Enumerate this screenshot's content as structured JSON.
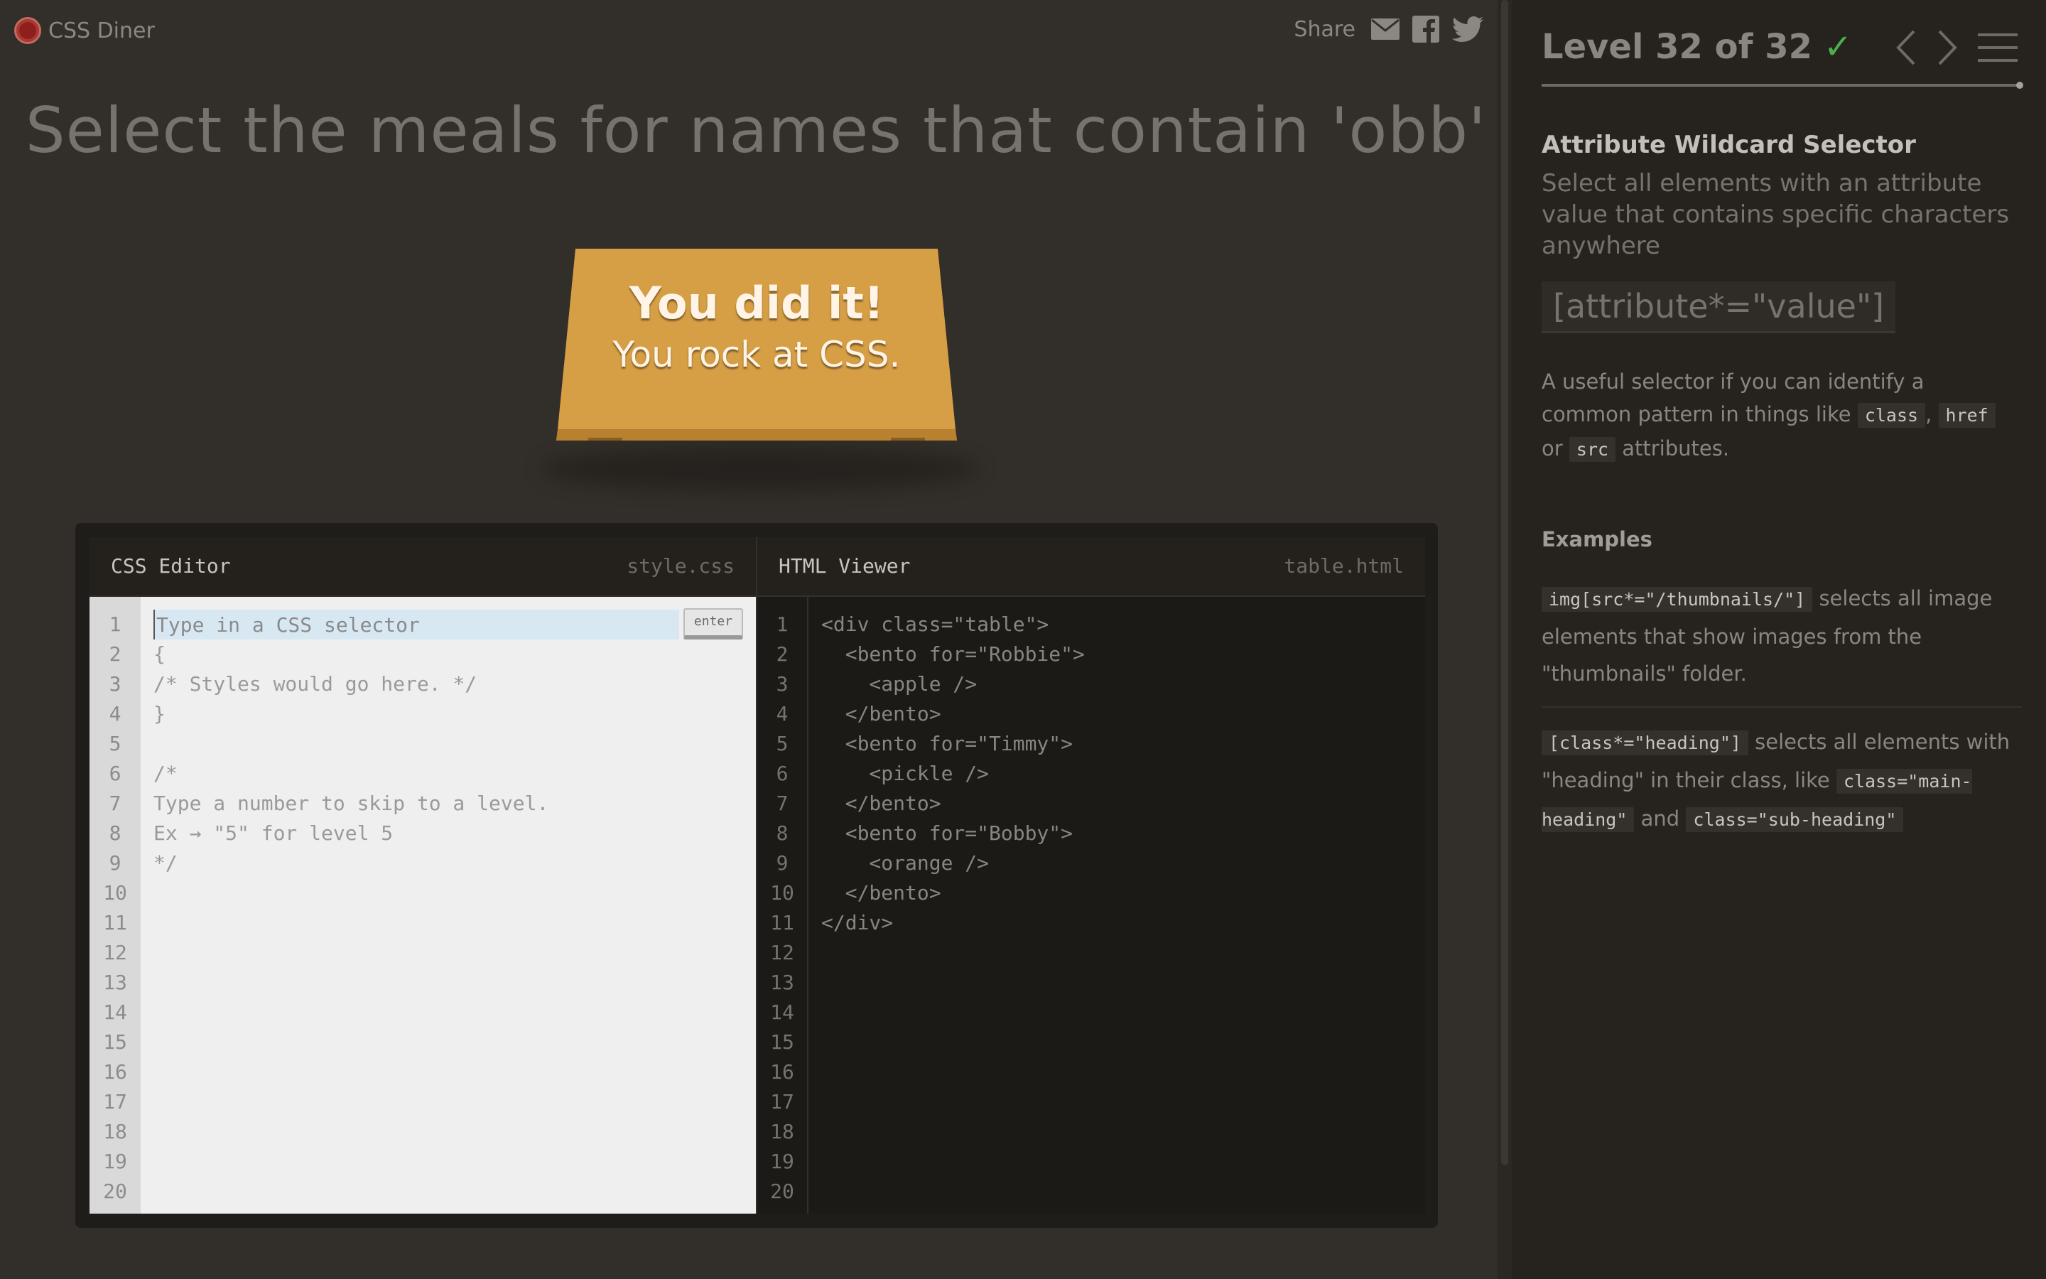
{
  "app": {
    "title": "CSS Diner"
  },
  "share": {
    "label": "Share",
    "icons": [
      "mail-icon",
      "facebook-icon",
      "twitter-icon"
    ]
  },
  "instruction": "Select the meals for names that contain 'obb'",
  "win": {
    "line1": "You did it!",
    "line2": "You rock at CSS."
  },
  "css_editor": {
    "title": "CSS Editor",
    "file": "style.css",
    "input_placeholder": "Type in a CSS selector",
    "enter_label": "enter",
    "lines": [
      "",
      "{",
      "/* Styles would go here. */",
      "}",
      "",
      "/*",
      "Type a number to skip to a level.",
      "Ex → \"5\" for level 5",
      "*/"
    ],
    "line_numbers": [
      "1",
      "2",
      "3",
      "4",
      "5",
      "6",
      "7",
      "8",
      "9",
      "10",
      "11",
      "12",
      "13",
      "14",
      "15",
      "16",
      "17",
      "18",
      "19",
      "20"
    ]
  },
  "html_viewer": {
    "title": "HTML Viewer",
    "file": "table.html",
    "lines": [
      "<div class=\"table\">",
      "  <bento for=\"Robbie\">",
      "    <apple />",
      "  </bento>",
      "  <bento for=\"Timmy\">",
      "    <pickle />",
      "  </bento>",
      "  <bento for=\"Bobby\">",
      "    <orange />",
      "  </bento>",
      "</div>"
    ],
    "line_numbers": [
      "1",
      "2",
      "3",
      "4",
      "5",
      "6",
      "7",
      "8",
      "9",
      "10",
      "11",
      "12",
      "13",
      "14",
      "15",
      "16",
      "17",
      "18",
      "19",
      "20"
    ]
  },
  "level": {
    "label": "Level 32 of 32",
    "check": "✓",
    "progress": 1.0
  },
  "selector": {
    "name": "Attribute Wildcard Selector",
    "title": "Select all elements with an attribute value that contains specific characters anywhere",
    "syntax": "[attribute*=\"value\"]",
    "hint_before": "A useful selector if you can identify a common pattern in things like",
    "hint_code1": "class",
    "hint_sep1": ",",
    "hint_code2": "href",
    "hint_sep2": "or",
    "hint_code3": "src",
    "hint_after": "attributes."
  },
  "examples": {
    "title": "Examples",
    "ex1_code": "img[src*=\"/thumbnails/\"]",
    "ex1_text": "selects all image elements that show images from the \"thumbnails\" folder.",
    "ex2_code": "[class*=\"heading\"]",
    "ex2_text": "selects all elements with \"heading\" in their class, like",
    "ex2_code2": "class=\"main-heading\"",
    "ex2_and": "and",
    "ex2_code3": "class=\"sub-heading\""
  },
  "colors": {
    "background": "#322e29",
    "sidebar": "#26231f",
    "table": "#d69e45",
    "check": "#4cae4c"
  }
}
